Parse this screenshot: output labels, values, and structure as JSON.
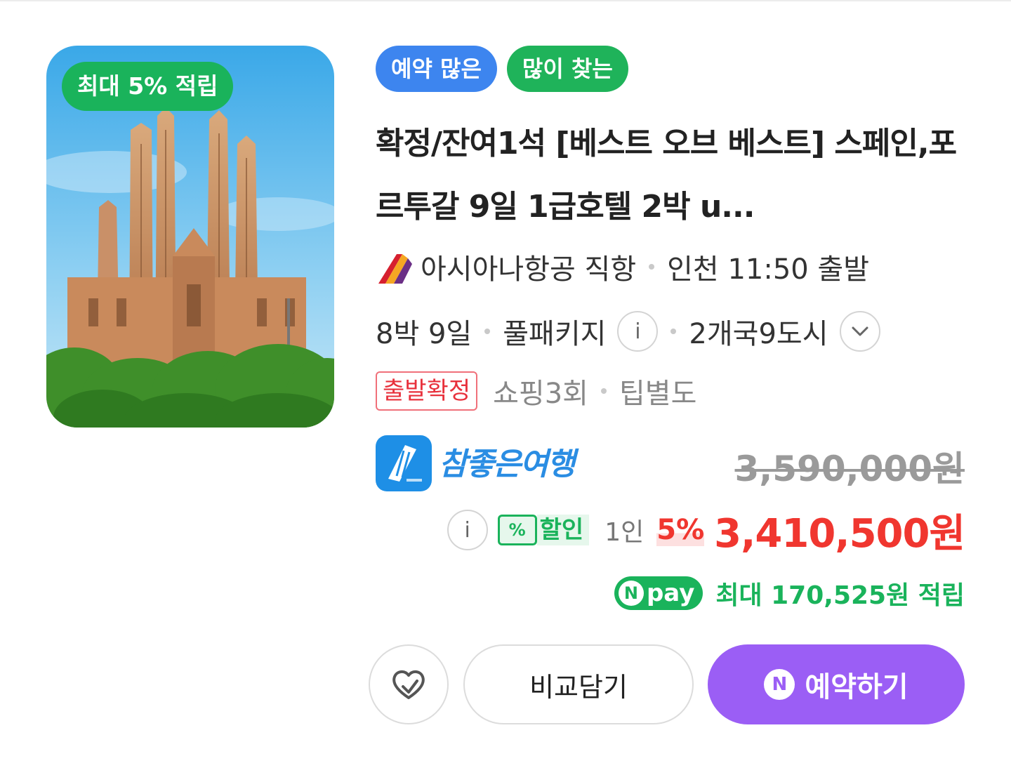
{
  "thumbnail": {
    "badge": "최대 5% 적립",
    "alt": "sagrada-familia-photo"
  },
  "tags": [
    "예약 많은",
    "많이 찾는"
  ],
  "title": "확정/잔여1석 [베스트 오브 베스트] 스페인,포르투갈 9일 1급호텔 2박 u...",
  "flight": {
    "airline": "아시아나항공 직항",
    "departure": "인천 11:50 출발"
  },
  "trip": {
    "duration": "8박 9일",
    "type": "풀패키지",
    "info_icon": "i",
    "cities": "2개국9도시",
    "expand_icon": "chevron-down-icon"
  },
  "details": {
    "confirm_badge": "출발확정",
    "shopping": "쇼핑3회",
    "tip": "팁별도"
  },
  "agency": {
    "name": "참좋은여행",
    "original_price": "3,590,000원"
  },
  "pricing": {
    "info_icon": "i",
    "discount_icon": "%",
    "discount_label": "할인",
    "per_person": "1인",
    "discount_pct": "5%",
    "final_price": "3,410,500원"
  },
  "npay": {
    "badge_n": "N",
    "badge_text": "pay",
    "reward_text": "최대 170,525원 적립"
  },
  "buttons": {
    "compare": "비교담기",
    "book_n": "N",
    "book": "예약하기"
  },
  "colors": {
    "green": "#1ab35b",
    "blue_tag": "#3d85ef",
    "price_red": "#f0362f",
    "purple": "#9b5ef5"
  }
}
